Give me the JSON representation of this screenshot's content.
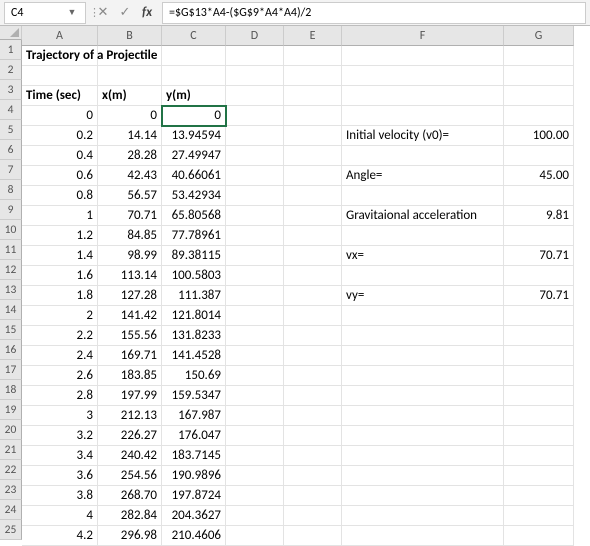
{
  "formulaBar": {
    "nameBox": "C4",
    "formula": "=$G$13*A4-($G$9*A4*A4)/2",
    "fx": "fx"
  },
  "columns": [
    "A",
    "B",
    "C",
    "D",
    "E",
    "F",
    "G"
  ],
  "rowCount": 25,
  "labels": {
    "title": "Trajectory of a Projectile",
    "timeHeader": "Time (sec)",
    "xHeader": "x(m)",
    "yHeader": "y(m)",
    "v0": "Initial velocity (v0)=",
    "angle": "Angle=",
    "grav": "Gravitaional acceleration",
    "vx": "vx=",
    "vy": "vy="
  },
  "params": {
    "v0": "100.00",
    "angle": "45.00",
    "grav": "9.81",
    "vx": "70.71",
    "vy": "70.71"
  },
  "traj": [
    {
      "t": "0",
      "x": "0",
      "y": "0"
    },
    {
      "t": "0.2",
      "x": "14.14",
      "y": "13.94594"
    },
    {
      "t": "0.4",
      "x": "28.28",
      "y": "27.49947"
    },
    {
      "t": "0.6",
      "x": "42.43",
      "y": "40.66061"
    },
    {
      "t": "0.8",
      "x": "56.57",
      "y": "53.42934"
    },
    {
      "t": "1",
      "x": "70.71",
      "y": "65.80568"
    },
    {
      "t": "1.2",
      "x": "84.85",
      "y": "77.78961"
    },
    {
      "t": "1.4",
      "x": "98.99",
      "y": "89.38115"
    },
    {
      "t": "1.6",
      "x": "113.14",
      "y": "100.5803"
    },
    {
      "t": "1.8",
      "x": "127.28",
      "y": "111.387"
    },
    {
      "t": "2",
      "x": "141.42",
      "y": "121.8014"
    },
    {
      "t": "2.2",
      "x": "155.56",
      "y": "131.8233"
    },
    {
      "t": "2.4",
      "x": "169.71",
      "y": "141.4528"
    },
    {
      "t": "2.6",
      "x": "183.85",
      "y": "150.69"
    },
    {
      "t": "2.8",
      "x": "197.99",
      "y": "159.5347"
    },
    {
      "t": "3",
      "x": "212.13",
      "y": "167.987"
    },
    {
      "t": "3.2",
      "x": "226.27",
      "y": "176.047"
    },
    {
      "t": "3.4",
      "x": "240.42",
      "y": "183.7145"
    },
    {
      "t": "3.6",
      "x": "254.56",
      "y": "190.9896"
    },
    {
      "t": "3.8",
      "x": "268.70",
      "y": "197.8724"
    },
    {
      "t": "4",
      "x": "282.84",
      "y": "204.3627"
    },
    {
      "t": "4.2",
      "x": "296.98",
      "y": "210.4606"
    }
  ],
  "chart_data": {
    "type": "table",
    "title": "Trajectory of a Projectile",
    "columns": [
      "Time (sec)",
      "x(m)",
      "y(m)"
    ],
    "series": [
      {
        "name": "Time (sec)",
        "values": [
          0,
          0.2,
          0.4,
          0.6,
          0.8,
          1,
          1.2,
          1.4,
          1.6,
          1.8,
          2,
          2.2,
          2.4,
          2.6,
          2.8,
          3,
          3.2,
          3.4,
          3.6,
          3.8,
          4,
          4.2
        ]
      },
      {
        "name": "x(m)",
        "values": [
          0,
          14.14,
          28.28,
          42.43,
          56.57,
          70.71,
          84.85,
          98.99,
          113.14,
          127.28,
          141.42,
          155.56,
          169.71,
          183.85,
          197.99,
          212.13,
          226.27,
          240.42,
          254.56,
          268.7,
          282.84,
          296.98
        ]
      },
      {
        "name": "y(m)",
        "values": [
          0,
          13.94594,
          27.49947,
          40.66061,
          53.42934,
          65.80568,
          77.78961,
          89.38115,
          100.5803,
          111.387,
          121.8014,
          131.8233,
          141.4528,
          150.69,
          159.5347,
          167.987,
          176.047,
          183.7145,
          190.9896,
          197.8724,
          204.3627,
          210.4606
        ]
      }
    ],
    "params": {
      "v0": 100.0,
      "angle": 45.0,
      "g": 9.81,
      "vx": 70.71,
      "vy": 70.71
    }
  }
}
